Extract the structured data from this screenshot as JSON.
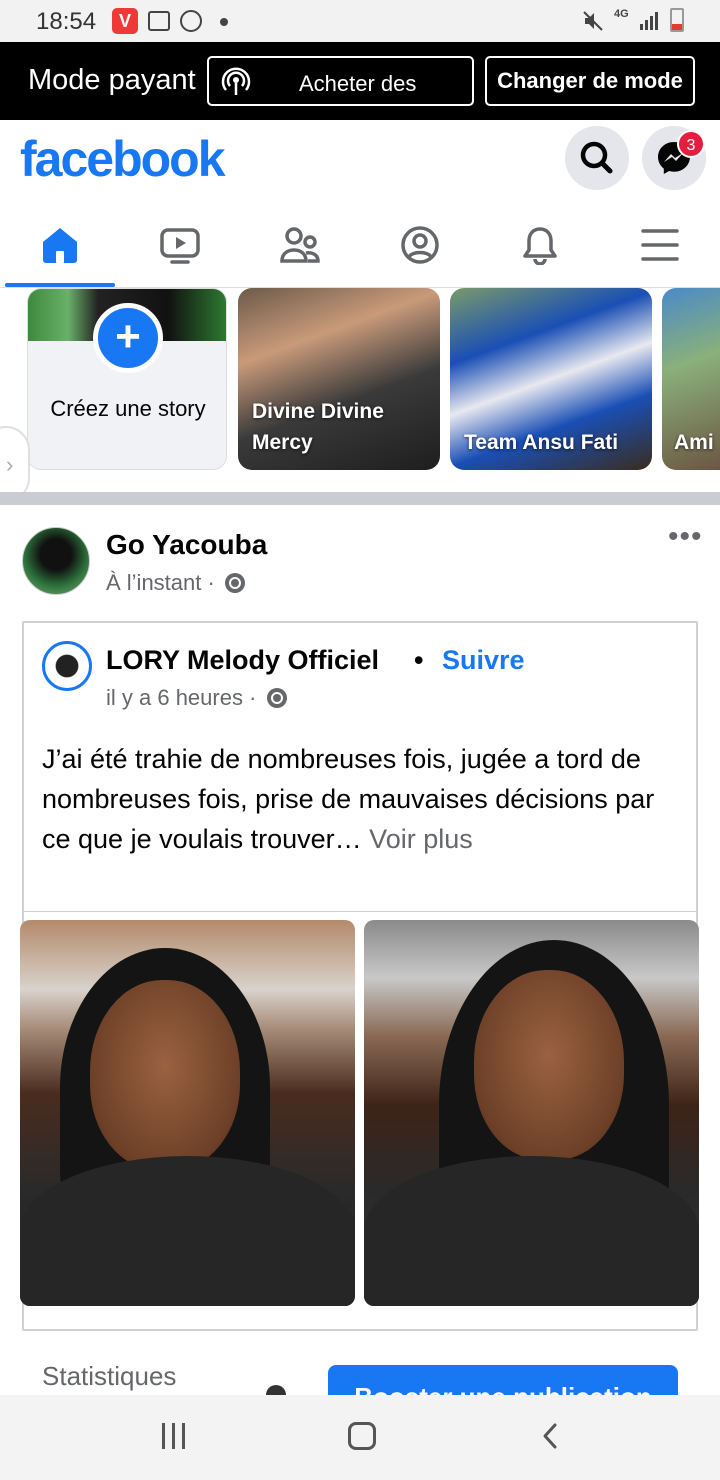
{
  "status_bar": {
    "time": "18:54",
    "network": "4G",
    "vivaldi_glyph": "V"
  },
  "mode_bar": {
    "title": "Mode payant",
    "buy_label": "Acheter des",
    "change_label": "Changer de mode"
  },
  "header": {
    "logo": "facebook",
    "messenger_badge": "3"
  },
  "nav_tabs": [
    {
      "name": "home-icon",
      "active": true
    },
    {
      "name": "watch-icon",
      "active": false
    },
    {
      "name": "friends-icon",
      "active": false
    },
    {
      "name": "profile-icon",
      "active": false
    },
    {
      "name": "notifications-icon",
      "active": false
    },
    {
      "name": "menu-icon",
      "active": false
    }
  ],
  "stories": {
    "create_label": "Créez une story",
    "items": [
      {
        "name": "Divine Divine Mercy"
      },
      {
        "name": "Team Ansu Fati"
      },
      {
        "name": "Ami"
      }
    ]
  },
  "post": {
    "author": "Go Yacouba",
    "time": "À l’instant ·",
    "shared": {
      "author": "LORY Melody Officiel",
      "dot": "•",
      "follow_label": "Suivre",
      "time": "il y a 6 heures ·",
      "text": "J’ai été trahie de nombreuses fois, jugée a tord de nombreuses fois, prise de mauvaises décisions par ce que je voulais trouver… ",
      "see_more": "Voir plus"
    },
    "stats_label": "Statistiques",
    "boost_label": "Booster une publication"
  }
}
